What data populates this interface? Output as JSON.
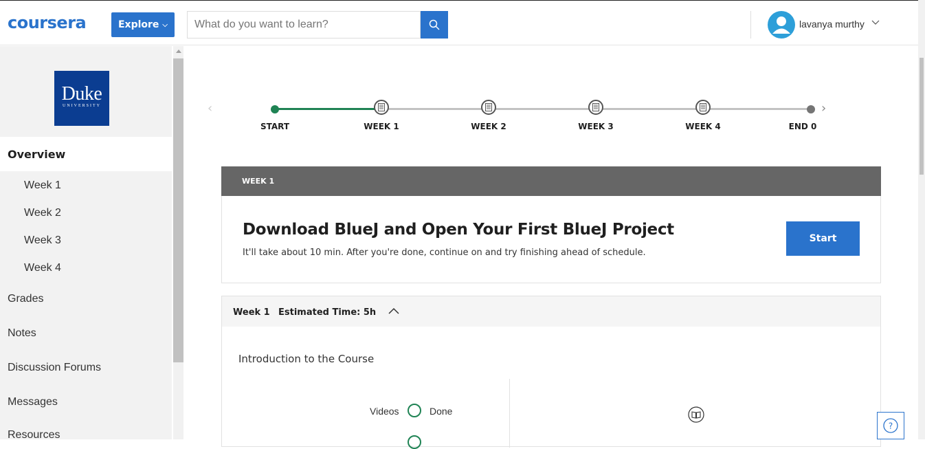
{
  "header": {
    "logo": "coursera",
    "explore_label": "Explore",
    "search_placeholder": "What do you want to learn?",
    "user_name": "lavanya murthy"
  },
  "sidebar": {
    "logo_text": "Duke",
    "logo_subtext": "UNIVERSITY",
    "active": "Overview",
    "weeks": [
      "Week 1",
      "Week 2",
      "Week 3",
      "Week 4"
    ],
    "items": [
      "Grades",
      "Notes",
      "Discussion Forums",
      "Messages",
      "Resources"
    ]
  },
  "timeline": {
    "nodes": [
      "START",
      "WEEK 1",
      "WEEK 2",
      "WEEK 3",
      "WEEK 4",
      "END 0"
    ],
    "done_color": "#1f8354",
    "end_color": "#757575"
  },
  "week_card": {
    "header": "WEEK 1",
    "title": "Download BlueJ and Open Your First BlueJ Project",
    "subtitle": "It'll take about 10 min. After you're done, continue on and try finishing ahead of schedule.",
    "button": "Start"
  },
  "accordion": {
    "week": "Week 1",
    "estimated": "Estimated Time: 5h",
    "section": "Introduction to the Course",
    "videos_label": "Videos",
    "status_label": "Done"
  },
  "colors": {
    "accent": "#2a73cc",
    "success": "#1f8354"
  }
}
